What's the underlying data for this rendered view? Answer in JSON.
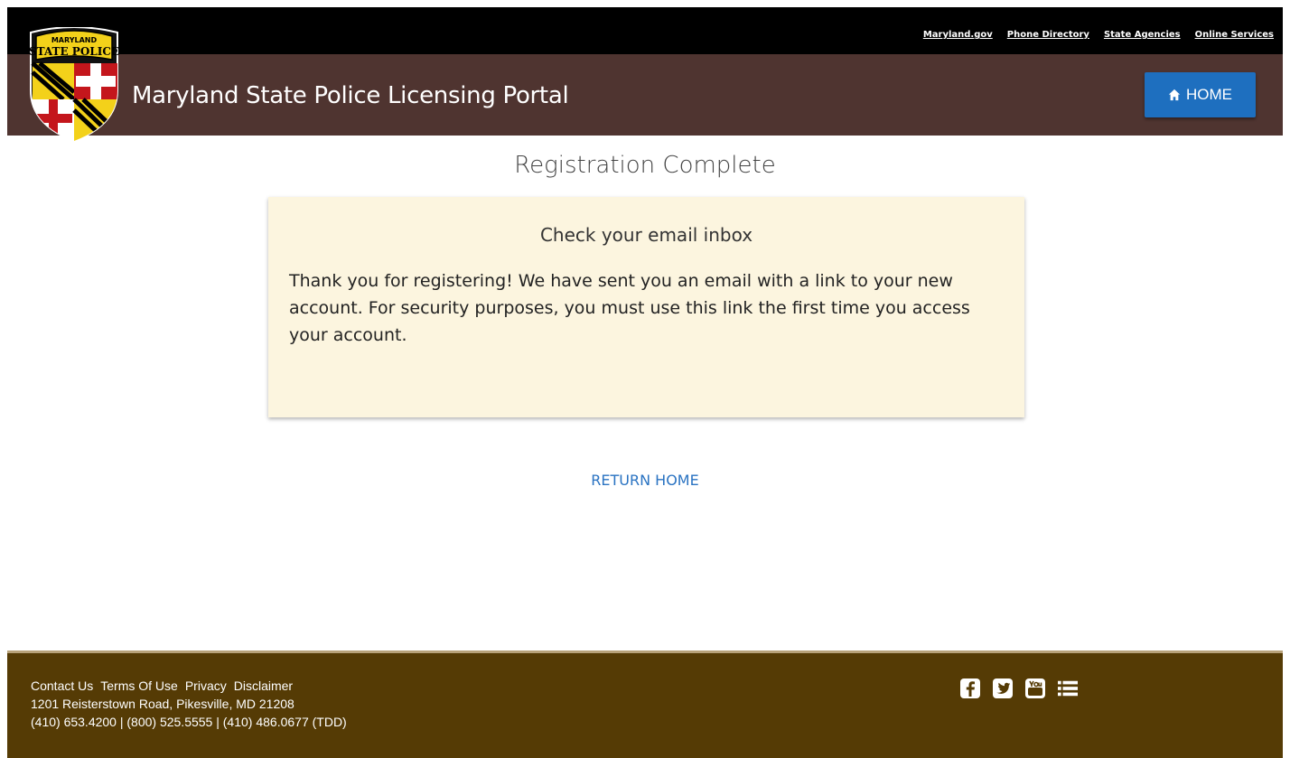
{
  "utility_links": [
    "Maryland.gov",
    "Phone Directory",
    "State Agencies",
    "Online Services"
  ],
  "header": {
    "title": "Maryland State Police Licensing Portal",
    "home_button": "HOME",
    "logo_text_top": "MARYLAND",
    "logo_text_main": "STATE POLICE"
  },
  "main": {
    "heading": "Registration Complete",
    "card_title": "Check your email inbox",
    "card_body": "Thank you for registering! We have sent you an email with a link to your new account. For security purposes, you must use this link the first time you access your account.",
    "return_link": "RETURN HOME"
  },
  "footer": {
    "links": [
      "Contact Us",
      "Terms Of Use",
      "Privacy",
      "Disclaimer"
    ],
    "address": "1201 Reisterstown Road, Pikesville, MD 21208",
    "phones": "(410) 653.4200 | (800) 525.5555 | (410) 486.0677 (TDD)",
    "social_icons": [
      "facebook-icon",
      "twitter-icon",
      "youtube-icon",
      "list-icon"
    ]
  },
  "colors": {
    "top_bar": "#000000",
    "header_bg": "#4f3430",
    "home_button": "#1e6fbf",
    "card_bg": "#fcf5df",
    "link": "#2a73c2",
    "footer_bg": "#553b05"
  }
}
